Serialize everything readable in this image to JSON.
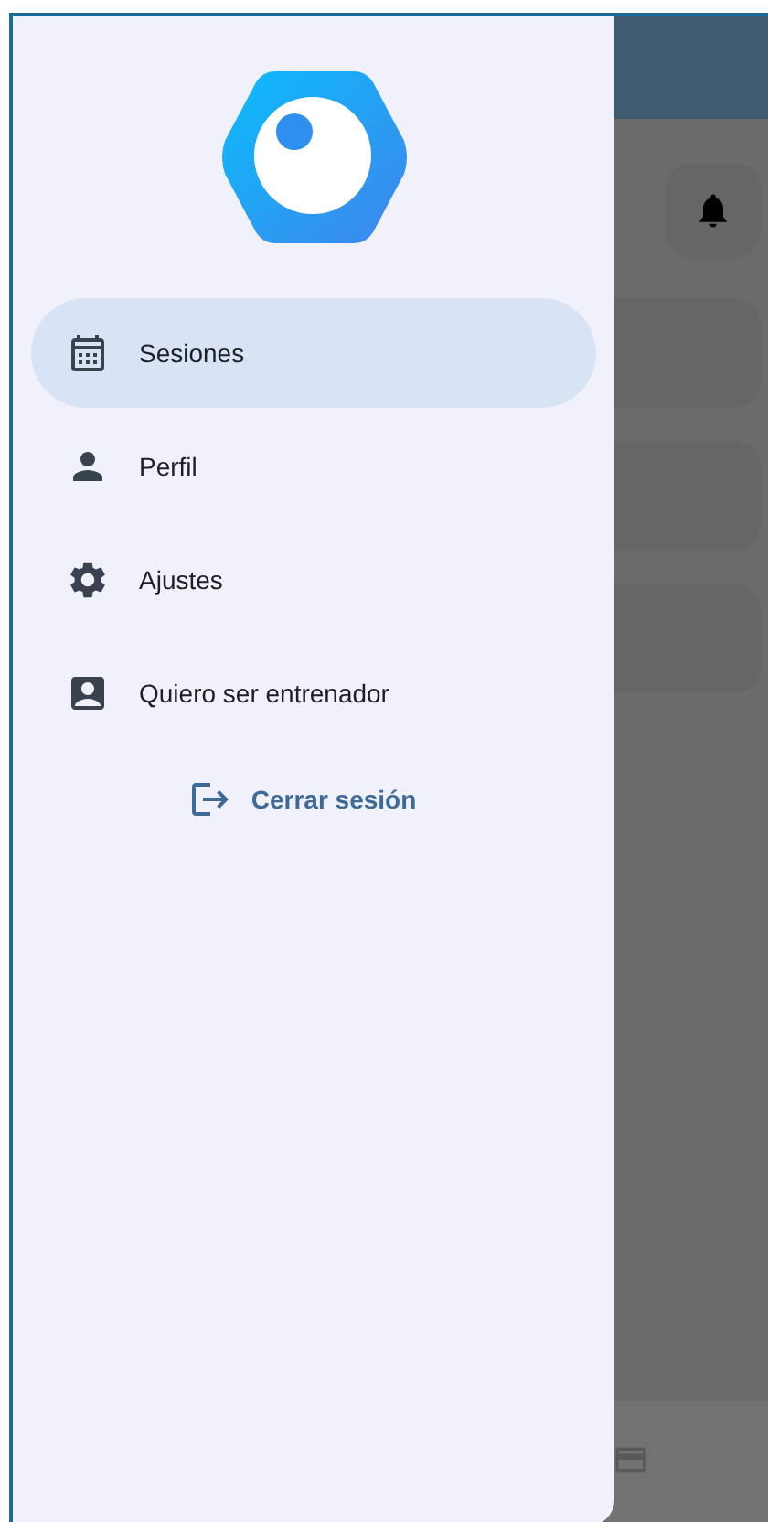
{
  "drawer": {
    "items": [
      {
        "kind": "calendar",
        "label": "Sesiones",
        "selected": true
      },
      {
        "kind": "person",
        "label": "Perfil",
        "selected": false
      },
      {
        "kind": "gear",
        "label": "Ajustes",
        "selected": false
      },
      {
        "kind": "badge",
        "label": "Quiero ser entrenador",
        "selected": false
      }
    ],
    "logout": {
      "label": "Cerrar sesión"
    }
  }
}
